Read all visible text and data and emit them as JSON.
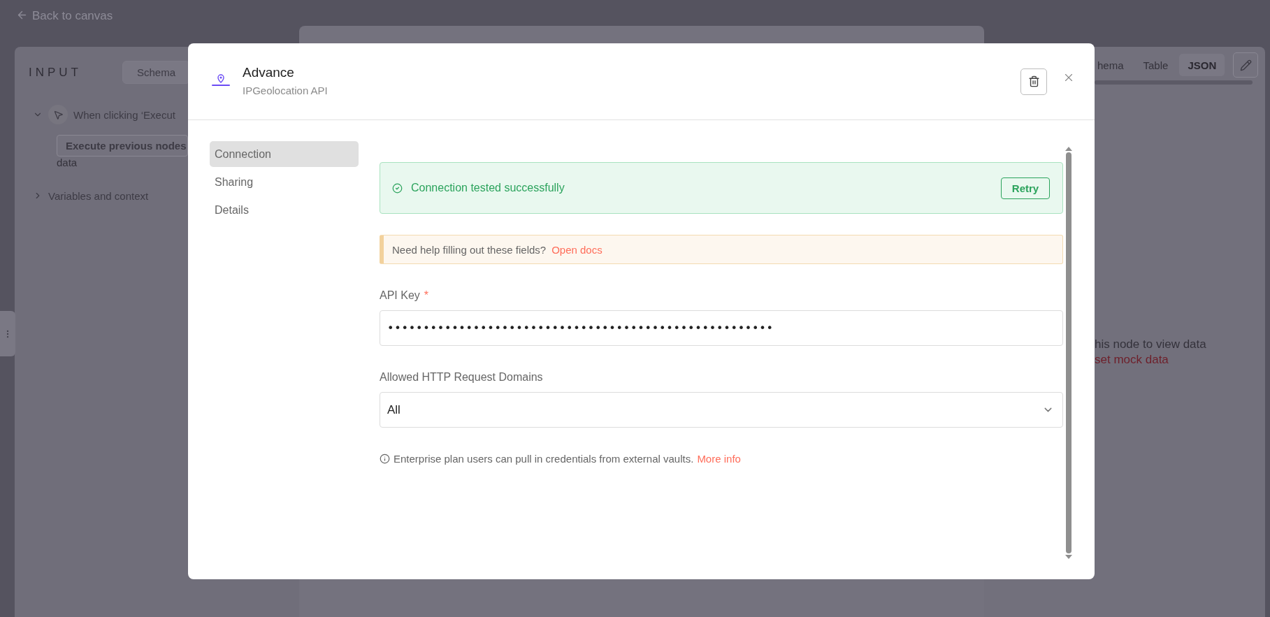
{
  "top_bar": {
    "back_link": "Back to canvas"
  },
  "input_panel": {
    "title": "INPUT",
    "view_button": "Schema",
    "tree": [
      {
        "label": "When clicking ‘Execut",
        "expanded": true,
        "action": "Execute previous nodes",
        "note": "data"
      },
      {
        "label": "Variables and context",
        "expanded": false
      }
    ]
  },
  "output_panel": {
    "tabs": [
      {
        "label": "hema",
        "selected": false
      },
      {
        "label": "Table",
        "selected": false
      },
      {
        "label": "JSON",
        "selected": true
      }
    ],
    "empty_message": "his node to view data",
    "mock_link": "set mock data"
  },
  "modal": {
    "title": "Advance",
    "subtitle": "IPGeolocation API",
    "nav": [
      {
        "label": "Connection",
        "selected": true
      },
      {
        "label": "Sharing",
        "selected": false
      },
      {
        "label": "Details",
        "selected": false
      }
    ],
    "banner": {
      "message": "Connection tested successfully",
      "button": "Retry"
    },
    "notice": {
      "text": "Need help filling out these fields?",
      "link": "Open docs"
    },
    "fields": [
      {
        "kind": "password",
        "label": "API Key",
        "required_mark": "*",
        "value": "••••••••••••••••••••••••••••••••••••••••••••••••••••••"
      },
      {
        "kind": "select",
        "label": "Allowed HTTP Request Domains",
        "value": "All"
      }
    ],
    "info": {
      "text": "Enterprise plan users can pull in credentials from external vaults.",
      "link": "More info"
    }
  }
}
